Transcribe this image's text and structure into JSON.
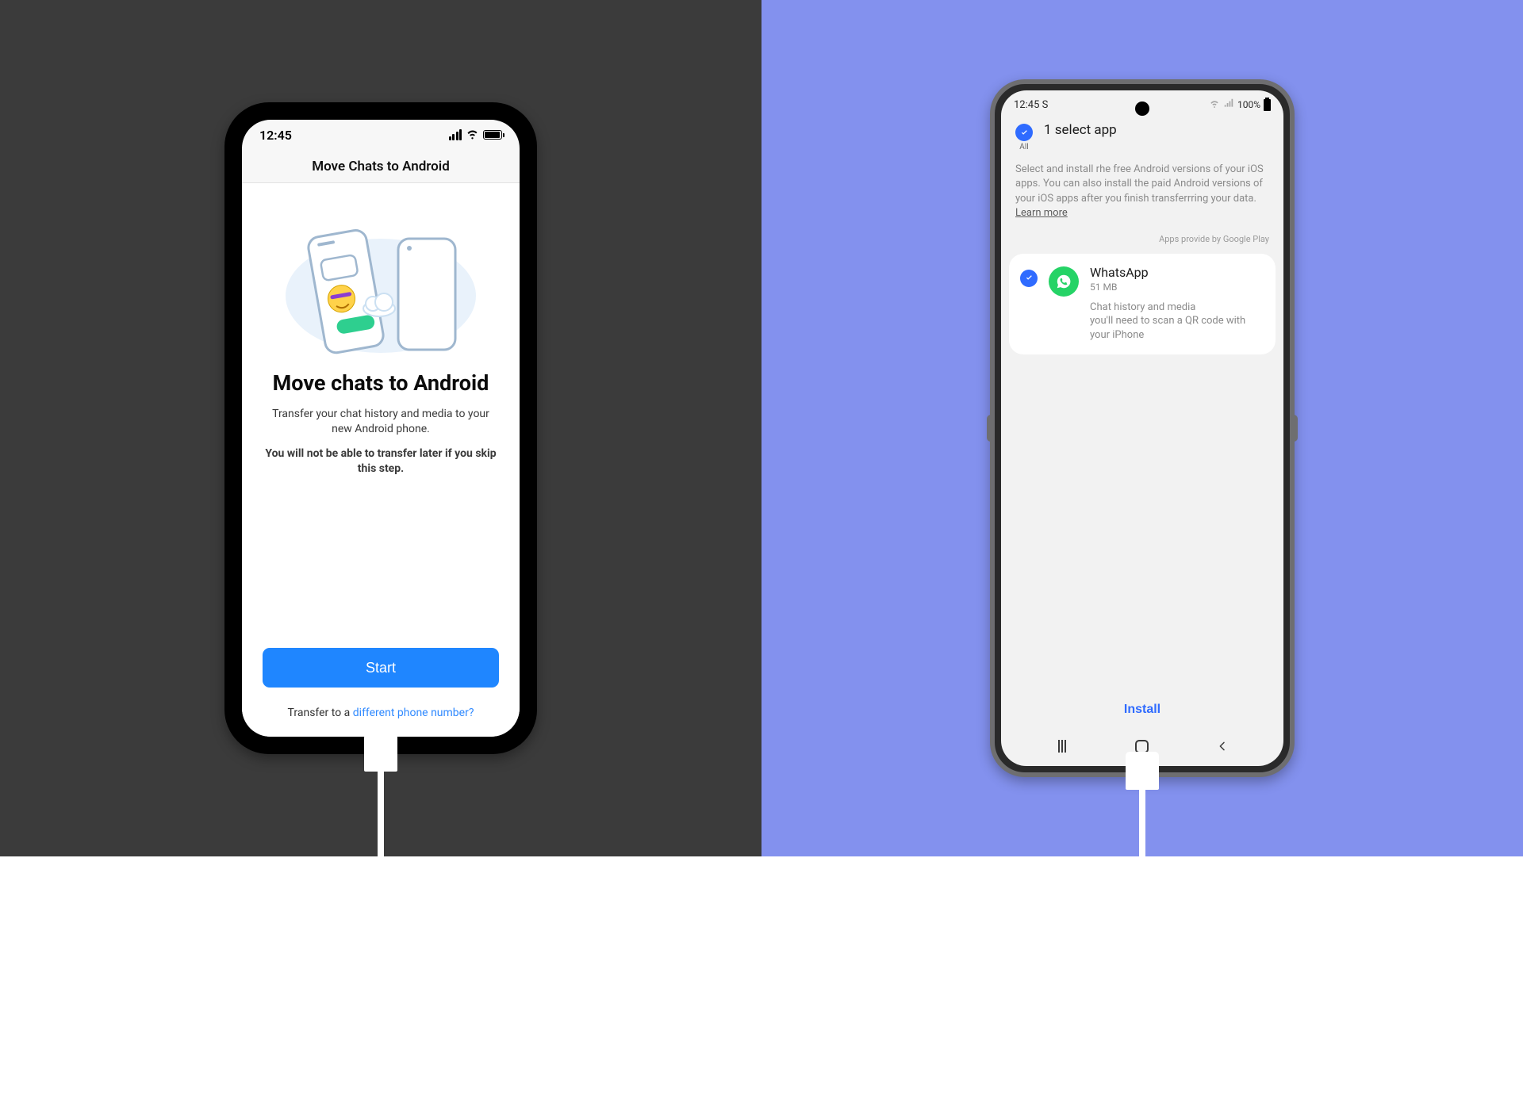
{
  "left": {
    "statusbar": {
      "time": "12:45"
    },
    "nav_title": "Move Chats to Android",
    "heading": "Move chats to Android",
    "paragraph": "Transfer your chat history and media to your new Android phone.",
    "warning": "You will not be able to transfer later if you skip this step.",
    "start_button": "Start",
    "footer_prefix": "Transfer to a ",
    "footer_link": "different phone number?"
  },
  "right": {
    "statusbar": {
      "time": "12:45 S",
      "battery_text": "100%"
    },
    "all_label": "All",
    "title": "1 select app",
    "description": "Select and install rhe free Android versions of your iOS apps. You can also install the paid Android versions of your iOS apps after you finish transferrring your data.",
    "learn_more": "Learn more",
    "provided_by": "Apps provide by Google Play",
    "app": {
      "name": "WhatsApp",
      "size": "51 MB",
      "sub1": "Chat history and media",
      "sub2": "you'll need to scan a QR code with your iPhone"
    },
    "install_button": "Install"
  }
}
